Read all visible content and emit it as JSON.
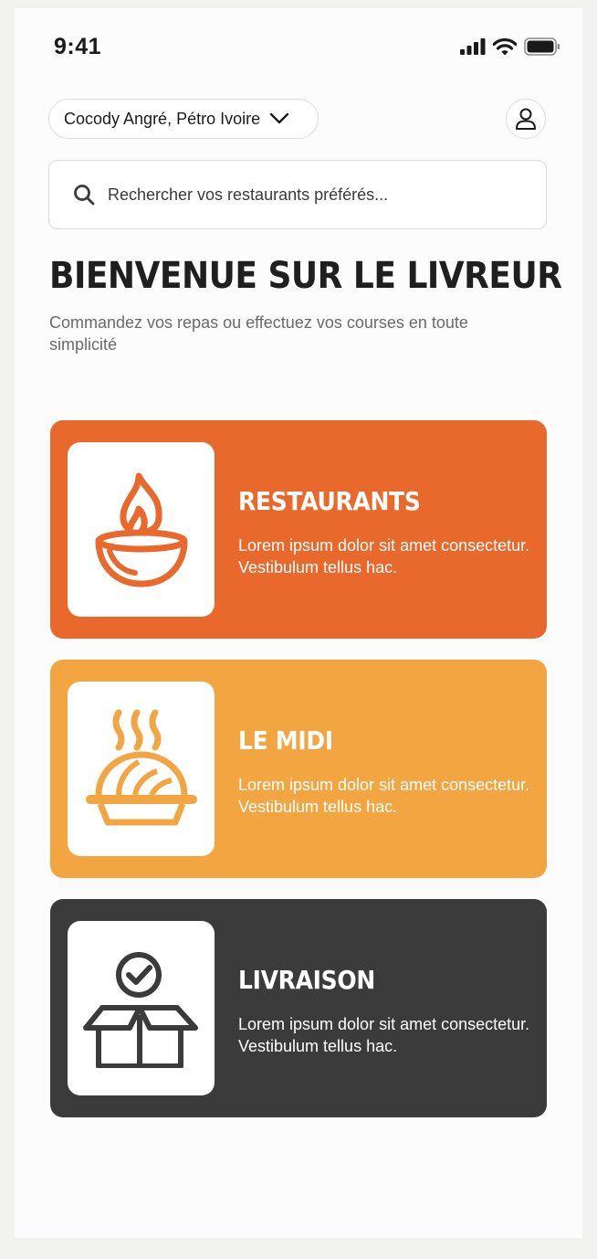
{
  "status_bar": {
    "time": "9:41",
    "signal_icon": "signal-bars-icon",
    "wifi_icon": "wifi-icon",
    "battery_icon": "battery-icon"
  },
  "header": {
    "location": "Cocody Angré, Pétro Ivoire",
    "location_icon": "chevron-down-icon",
    "profile_icon": "user-icon"
  },
  "search": {
    "placeholder": "Rechercher vos restaurants préférés...",
    "icon": "search-icon"
  },
  "welcome": {
    "title": "BIENVENUE SUR LE LIVREUR",
    "subtitle": "Commandez vos repas ou effectuez vos courses en toute simplicité"
  },
  "cards": [
    {
      "title": "RESTAURANTS",
      "description": "Lorem ipsum dolor sit amet consectetur. Vestibulum tellus hac.",
      "icon": "flame-bowl-icon",
      "color": "#e9692d"
    },
    {
      "title": "LE MIDI",
      "description": "Lorem ipsum dolor sit amet consectetur. Vestibulum tellus hac.",
      "icon": "hot-dish-icon",
      "color": "#f2a541"
    },
    {
      "title": "LIVRAISON",
      "description": "Lorem ipsum dolor sit amet consectetur. Vestibulum tellus hac.",
      "icon": "delivery-box-check-icon",
      "color": "#3b3b3b"
    }
  ]
}
